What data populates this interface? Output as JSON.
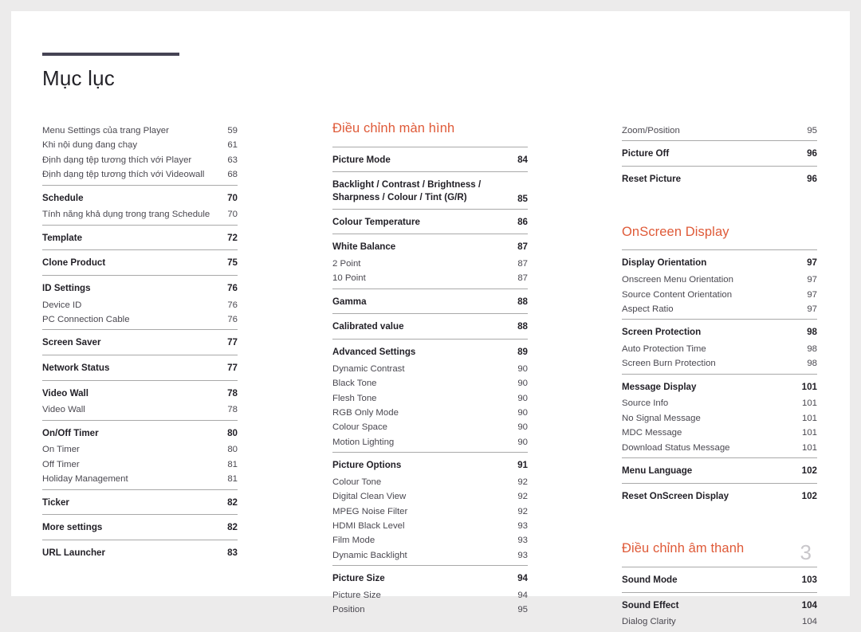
{
  "document": {
    "title": "Mục lục",
    "folio": "3",
    "accent_color": "#df5a38",
    "rule_color": "#454354"
  },
  "columns": [
    {
      "id": "column-1",
      "heading": null,
      "groups": [
        {
          "rule": false,
          "entries": [
            {
              "type": "minor",
              "label": "Menu Settings của trang Player",
              "page": "59"
            },
            {
              "type": "minor",
              "label": "Khi nội dung đang chạy",
              "page": "61"
            },
            {
              "type": "minor",
              "label": "Định dạng tệp tương thích với Player",
              "page": "63"
            },
            {
              "type": "minor",
              "label": "Định dạng tệp tương thích với Videowall",
              "page": "68"
            }
          ]
        },
        {
          "rule": true,
          "entries": [
            {
              "type": "major",
              "label": "Schedule",
              "page": "70"
            },
            {
              "type": "minor",
              "label": "Tính năng khả dụng trong trang Schedule",
              "page": "70"
            }
          ]
        },
        {
          "rule": true,
          "entries": [
            {
              "type": "major",
              "label": "Template",
              "page": "72"
            }
          ]
        },
        {
          "rule": true,
          "entries": [
            {
              "type": "major",
              "label": "Clone Product",
              "page": "75"
            }
          ]
        },
        {
          "rule": true,
          "entries": [
            {
              "type": "major",
              "label": "ID Settings",
              "page": "76"
            },
            {
              "type": "minor",
              "label": "Device ID",
              "page": "76"
            },
            {
              "type": "minor",
              "label": "PC Connection Cable",
              "page": "76"
            }
          ]
        },
        {
          "rule": true,
          "entries": [
            {
              "type": "major",
              "label": "Screen Saver",
              "page": "77"
            }
          ]
        },
        {
          "rule": true,
          "entries": [
            {
              "type": "major",
              "label": "Network Status",
              "page": "77"
            }
          ]
        },
        {
          "rule": true,
          "entries": [
            {
              "type": "major",
              "label": "Video Wall",
              "page": "78"
            },
            {
              "type": "minor",
              "label": "Video Wall",
              "page": "78"
            }
          ]
        },
        {
          "rule": true,
          "entries": [
            {
              "type": "major",
              "label": "On/Off Timer",
              "page": "80"
            },
            {
              "type": "minor",
              "label": "On Timer",
              "page": "80"
            },
            {
              "type": "minor",
              "label": "Off Timer",
              "page": "81"
            },
            {
              "type": "minor",
              "label": "Holiday Management",
              "page": "81"
            }
          ]
        },
        {
          "rule": true,
          "entries": [
            {
              "type": "major",
              "label": "Ticker",
              "page": "82"
            }
          ]
        },
        {
          "rule": true,
          "entries": [
            {
              "type": "major",
              "label": "More settings",
              "page": "82"
            }
          ]
        },
        {
          "rule": true,
          "entries": [
            {
              "type": "major",
              "label": "URL Launcher",
              "page": "83"
            }
          ]
        }
      ]
    },
    {
      "id": "column-2",
      "heading": "Điều chỉnh màn hình",
      "groups": [
        {
          "rule": true,
          "entries": [
            {
              "type": "major",
              "label": "Picture Mode",
              "page": "84"
            }
          ]
        },
        {
          "rule": true,
          "entries": [
            {
              "type": "major",
              "multiline": true,
              "label": "Backlight / Contrast / Brightness /\nSharpness / Colour / Tint (G/R)",
              "page": "85"
            }
          ]
        },
        {
          "rule": true,
          "entries": [
            {
              "type": "major",
              "label": "Colour Temperature",
              "page": "86"
            }
          ]
        },
        {
          "rule": true,
          "entries": [
            {
              "type": "major",
              "label": "White Balance",
              "page": "87"
            },
            {
              "type": "minor",
              "label": "2 Point",
              "page": "87"
            },
            {
              "type": "minor",
              "label": "10 Point",
              "page": "87"
            }
          ]
        },
        {
          "rule": true,
          "entries": [
            {
              "type": "major",
              "label": "Gamma",
              "page": "88"
            }
          ]
        },
        {
          "rule": true,
          "entries": [
            {
              "type": "major",
              "label": "Calibrated value",
              "page": "88"
            }
          ]
        },
        {
          "rule": true,
          "entries": [
            {
              "type": "major",
              "label": "Advanced Settings",
              "page": "89"
            },
            {
              "type": "minor",
              "label": "Dynamic Contrast",
              "page": "90"
            },
            {
              "type": "minor",
              "label": "Black Tone",
              "page": "90"
            },
            {
              "type": "minor",
              "label": "Flesh Tone",
              "page": "90"
            },
            {
              "type": "minor",
              "label": "RGB Only Mode",
              "page": "90"
            },
            {
              "type": "minor",
              "label": "Colour Space",
              "page": "90"
            },
            {
              "type": "minor",
              "label": "Motion Lighting",
              "page": "90"
            }
          ]
        },
        {
          "rule": true,
          "entries": [
            {
              "type": "major",
              "label": "Picture Options",
              "page": "91"
            },
            {
              "type": "minor",
              "label": "Colour Tone",
              "page": "92"
            },
            {
              "type": "minor",
              "label": "Digital Clean View",
              "page": "92"
            },
            {
              "type": "minor",
              "label": "MPEG Noise Filter",
              "page": "92"
            },
            {
              "type": "minor",
              "label": "HDMI Black Level",
              "page": "93"
            },
            {
              "type": "minor",
              "label": "Film Mode",
              "page": "93"
            },
            {
              "type": "minor",
              "label": "Dynamic Backlight",
              "page": "93"
            }
          ]
        },
        {
          "rule": true,
          "entries": [
            {
              "type": "major",
              "label": "Picture Size",
              "page": "94"
            },
            {
              "type": "minor",
              "label": "Picture Size",
              "page": "94"
            },
            {
              "type": "minor",
              "label": "Position",
              "page": "95"
            }
          ]
        }
      ]
    },
    {
      "id": "column-3",
      "heading": null,
      "groups": [
        {
          "rule": false,
          "entries": [
            {
              "type": "minor",
              "label": "Zoom/Position",
              "page": "95"
            }
          ]
        },
        {
          "rule": true,
          "entries": [
            {
              "type": "major",
              "label": "Picture Off",
              "page": "96"
            }
          ]
        },
        {
          "rule": true,
          "entries": [
            {
              "type": "major",
              "label": "Reset Picture",
              "page": "96"
            }
          ]
        }
      ],
      "sections": [
        {
          "heading": "OnScreen Display",
          "groups": [
            {
              "rule": true,
              "entries": [
                {
                  "type": "major",
                  "label": "Display Orientation",
                  "page": "97"
                },
                {
                  "type": "minor",
                  "label": "Onscreen Menu Orientation",
                  "page": "97"
                },
                {
                  "type": "minor",
                  "label": "Source Content Orientation",
                  "page": "97"
                },
                {
                  "type": "minor",
                  "label": "Aspect Ratio",
                  "page": "97"
                }
              ]
            },
            {
              "rule": true,
              "entries": [
                {
                  "type": "major",
                  "label": "Screen Protection",
                  "page": "98"
                },
                {
                  "type": "minor",
                  "label": "Auto Protection Time",
                  "page": "98"
                },
                {
                  "type": "minor",
                  "label": "Screen Burn Protection",
                  "page": "98"
                }
              ]
            },
            {
              "rule": true,
              "entries": [
                {
                  "type": "major",
                  "label": "Message Display",
                  "page": "101"
                },
                {
                  "type": "minor",
                  "label": "Source Info",
                  "page": "101"
                },
                {
                  "type": "minor",
                  "label": "No Signal Message",
                  "page": "101"
                },
                {
                  "type": "minor",
                  "label": "MDC Message",
                  "page": "101"
                },
                {
                  "type": "minor",
                  "label": "Download Status Message",
                  "page": "101"
                }
              ]
            },
            {
              "rule": true,
              "entries": [
                {
                  "type": "major",
                  "label": "Menu Language",
                  "page": "102"
                }
              ]
            },
            {
              "rule": true,
              "entries": [
                {
                  "type": "major",
                  "label": "Reset OnScreen Display",
                  "page": "102"
                }
              ]
            }
          ]
        },
        {
          "heading": "Điều chỉnh âm thanh",
          "groups": [
            {
              "rule": true,
              "entries": [
                {
                  "type": "major",
                  "label": "Sound Mode",
                  "page": "103"
                }
              ]
            },
            {
              "rule": true,
              "entries": [
                {
                  "type": "major",
                  "label": "Sound Effect",
                  "page": "104"
                },
                {
                  "type": "minor",
                  "label": "Dialog Clarity",
                  "page": "104"
                }
              ]
            }
          ]
        }
      ]
    }
  ]
}
